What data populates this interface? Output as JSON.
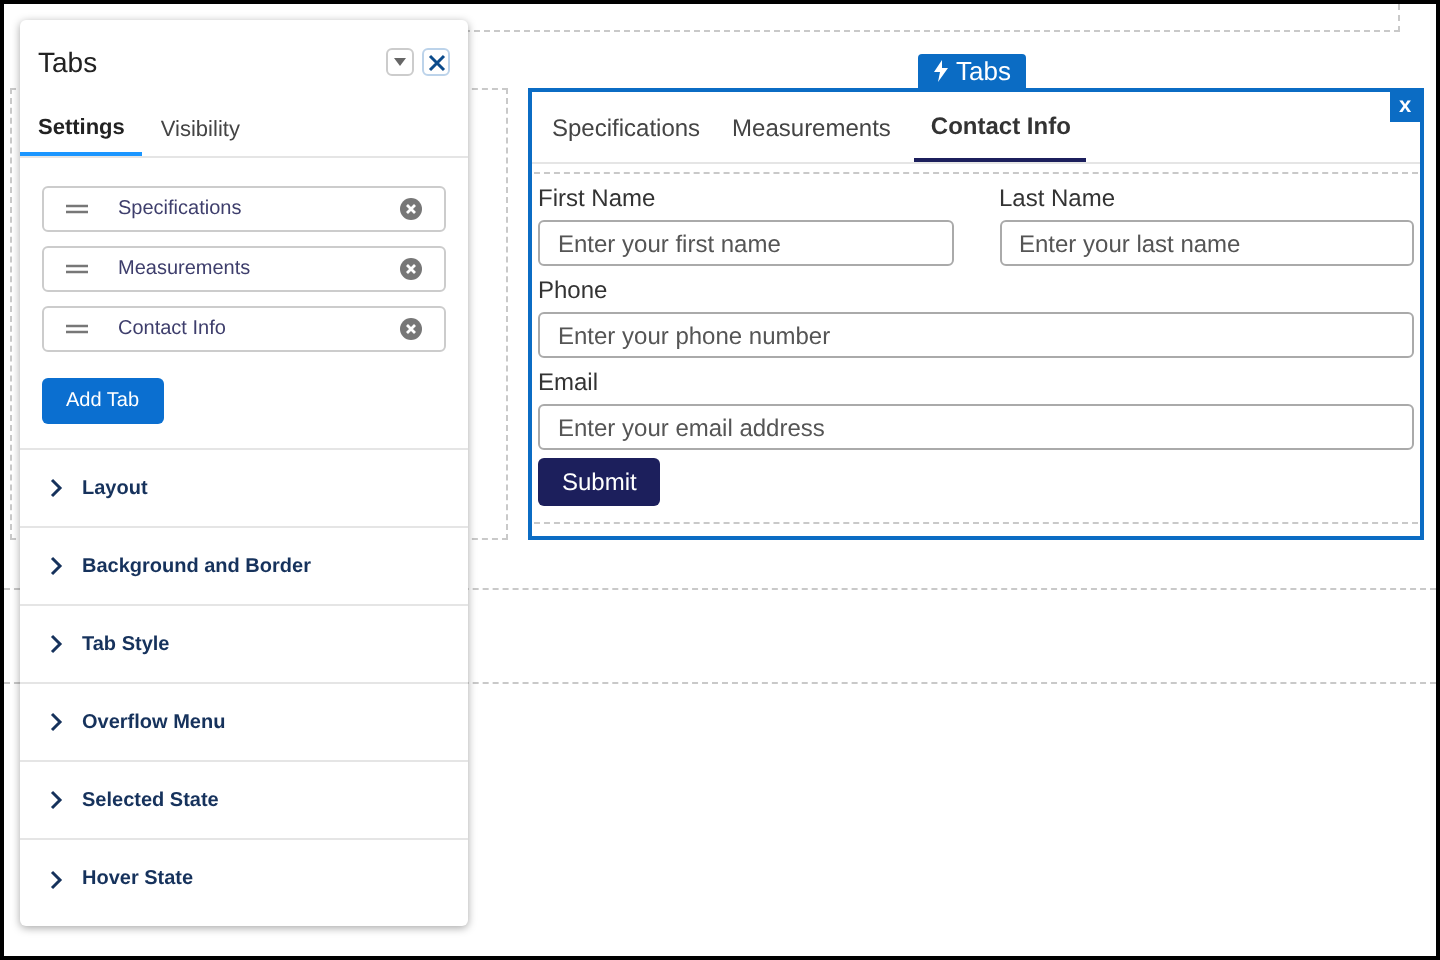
{
  "panel": {
    "title": "Tabs",
    "tabs": [
      {
        "label": "Settings",
        "selected": true
      },
      {
        "label": "Visibility",
        "selected": false
      }
    ],
    "tab_items": [
      "Specifications",
      "Measurements",
      "Contact Info"
    ],
    "add_button": "Add Tab",
    "sections": [
      {
        "label": "Layout",
        "expanded": false
      },
      {
        "label": "Background and Border",
        "expanded": false
      },
      {
        "label": "Tab Style",
        "expanded": false
      },
      {
        "label": "Overflow Menu",
        "expanded": false
      },
      {
        "label": "Selected State",
        "expanded": false
      },
      {
        "label": "Hover State",
        "expanded": false
      }
    ]
  },
  "widget": {
    "badge": "Tabs",
    "close": "x",
    "tabs": [
      {
        "label": "Specifications",
        "selected": false
      },
      {
        "label": "Measurements",
        "selected": false
      },
      {
        "label": "Contact Info",
        "selected": true
      }
    ],
    "form_rows": [
      [
        {
          "label": "First Name",
          "placeholder": "Enter your first name"
        },
        {
          "label": "Last Name",
          "placeholder": "Enter your last name"
        }
      ],
      [
        {
          "label": "Phone",
          "placeholder": "Enter your phone number"
        }
      ],
      [
        {
          "label": "Email",
          "placeholder": "Enter your email address"
        }
      ]
    ],
    "submit": "Submit"
  }
}
